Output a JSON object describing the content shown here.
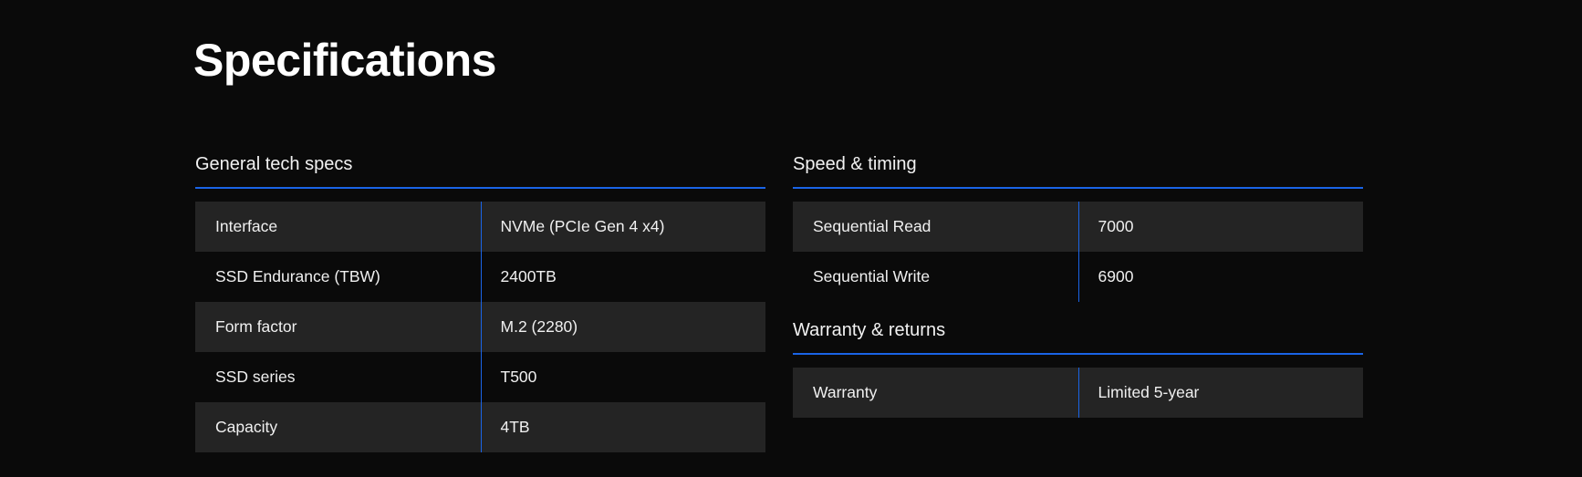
{
  "page": {
    "title": "Specifications"
  },
  "sections": {
    "general": {
      "heading": "General tech specs",
      "rows": [
        {
          "label": "Interface",
          "value": "NVMe (PCIe Gen 4 x4)"
        },
        {
          "label": "SSD Endurance (TBW)",
          "value": "2400TB"
        },
        {
          "label": "Form factor",
          "value": "M.2 (2280)"
        },
        {
          "label": "SSD series",
          "value": "T500"
        },
        {
          "label": "Capacity",
          "value": "4TB"
        }
      ]
    },
    "speed": {
      "heading": "Speed & timing",
      "rows": [
        {
          "label": "Sequential Read",
          "value": "7000"
        },
        {
          "label": "Sequential Write",
          "value": "6900"
        }
      ]
    },
    "warranty": {
      "heading": "Warranty & returns",
      "rows": [
        {
          "label": "Warranty",
          "value": "Limited 5-year"
        }
      ]
    }
  },
  "colors": {
    "background": "#0a0a0a",
    "row_shaded": "#242424",
    "accent_blue": "#1a64e6",
    "text": "#ffffff"
  }
}
